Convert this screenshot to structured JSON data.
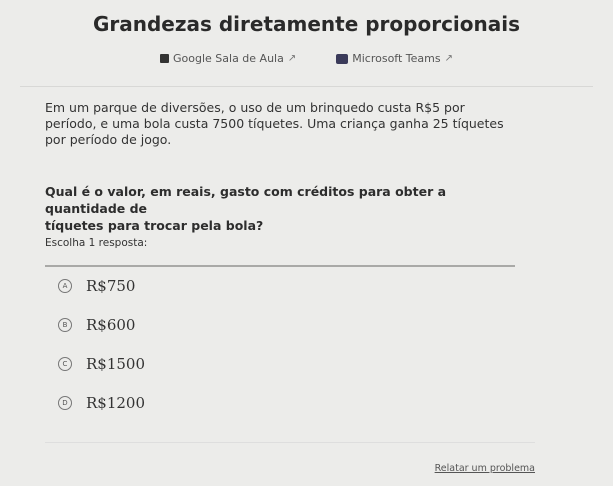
{
  "title": "Grandezas diretamente proporcionais",
  "share": {
    "google": {
      "label": "Google Sala de Aula",
      "icon": "google-classroom-icon"
    },
    "teams": {
      "label": "Microsoft Teams",
      "icon": "microsoft-teams-icon"
    },
    "external_icon": "external-link-icon"
  },
  "question": {
    "lines": [
      "Em um parque de diversões, o uso de um brinquedo custa R$5 por",
      "período, e uma bola custa 7500 tíquetes. Uma criança ganha 25 tíquetes",
      "por período de jogo."
    ],
    "ask_lines": [
      "Qual é o valor, em reais, gasto com créditos para obter a quantidade de",
      "tíquetes para trocar pela bola?"
    ]
  },
  "instruction": "Escolha 1 resposta:",
  "options": [
    {
      "letter": "A",
      "text": "R$750"
    },
    {
      "letter": "B",
      "text": "R$600"
    },
    {
      "letter": "C",
      "text": "R$1500"
    },
    {
      "letter": "D",
      "text": "R$1200"
    }
  ],
  "report_link": "Relatar um problema"
}
